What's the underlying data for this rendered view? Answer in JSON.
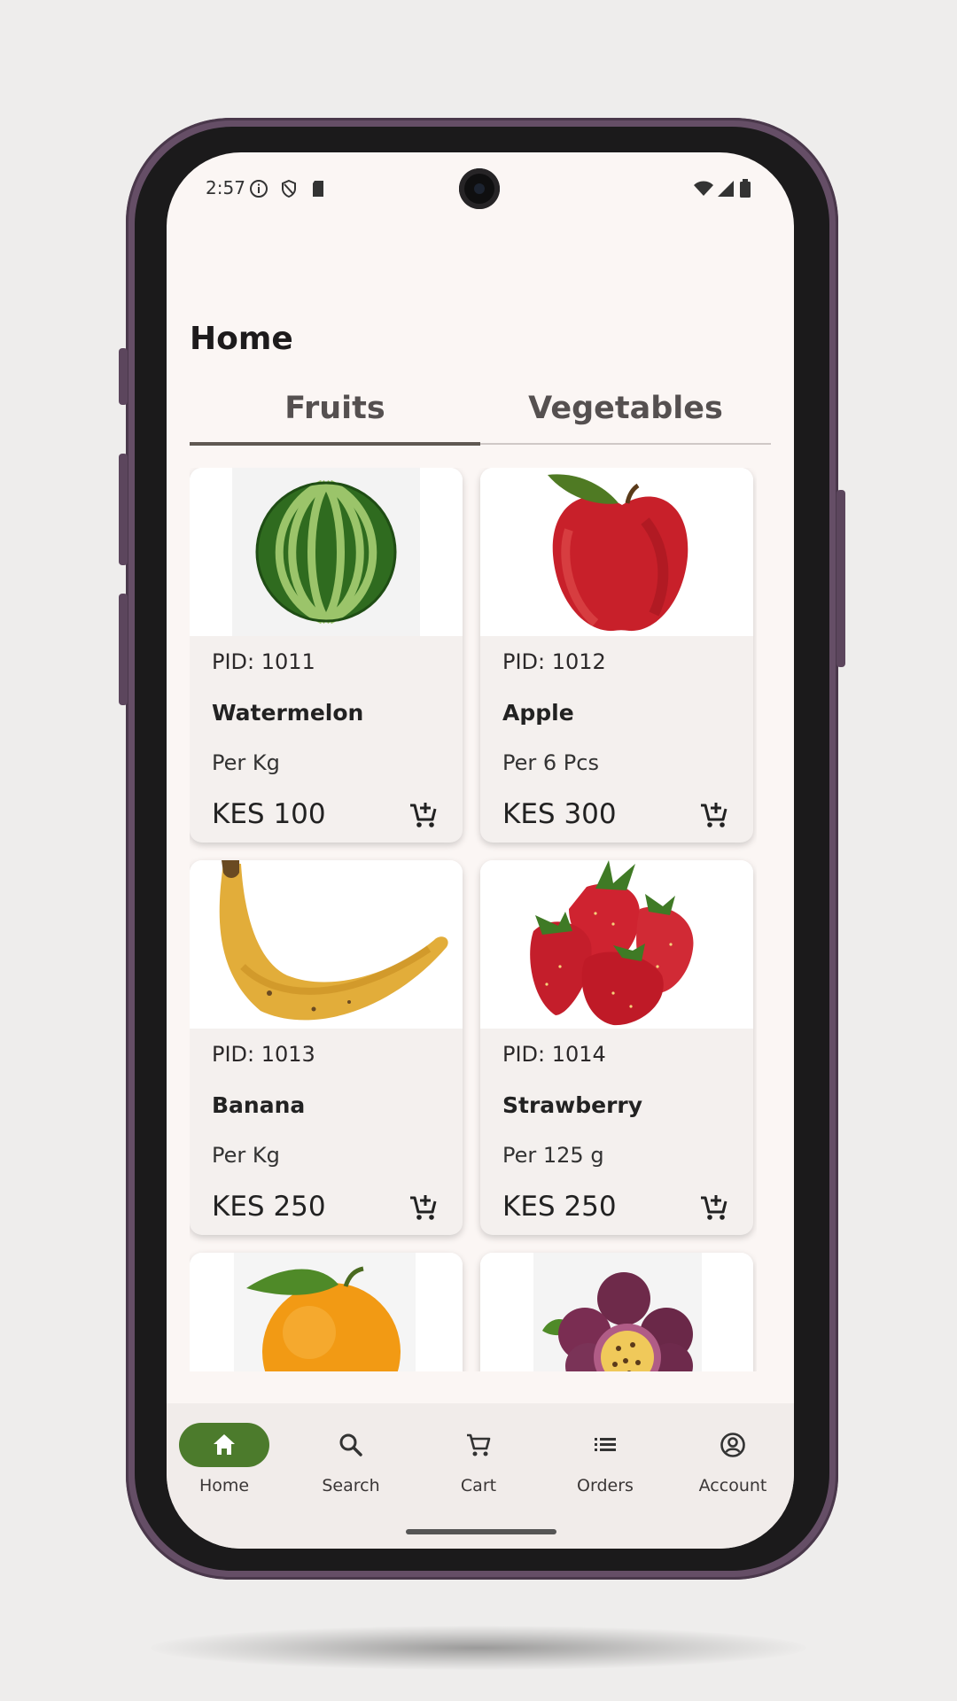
{
  "status_bar": {
    "time": "2:57"
  },
  "header": {
    "title": "Home"
  },
  "tabs": [
    {
      "label": "Fruits",
      "active": true
    },
    {
      "label": "Vegetables",
      "active": false
    }
  ],
  "products": [
    {
      "pid": "PID: 1011",
      "name": "Watermelon",
      "unit": "Per Kg",
      "price": "KES 100",
      "image": "watermelon-image"
    },
    {
      "pid": "PID: 1012",
      "name": "Apple",
      "unit": "Per 6 Pcs",
      "price": "KES 300",
      "image": "apple-image"
    },
    {
      "pid": "PID: 1013",
      "name": "Banana",
      "unit": "Per Kg",
      "price": "KES 250",
      "image": "banana-image"
    },
    {
      "pid": "PID: 1014",
      "name": "Strawberry",
      "unit": "Per 125 g",
      "price": "KES 250",
      "image": "strawberry-image"
    },
    {
      "image": "orange-image"
    },
    {
      "image": "passion-fruit-image"
    }
  ],
  "nav": [
    {
      "label": "Home",
      "icon": "home-icon",
      "active": true
    },
    {
      "label": "Search",
      "icon": "search-icon",
      "active": false
    },
    {
      "label": "Cart",
      "icon": "cart-icon",
      "active": false
    },
    {
      "label": "Orders",
      "icon": "list-icon",
      "active": false
    },
    {
      "label": "Account",
      "icon": "account-circle-icon",
      "active": false
    }
  ],
  "colors": {
    "accent": "#4c7b2c",
    "background": "#fbf6f4",
    "card": "#f4f0ee",
    "frame": "#654e66"
  }
}
